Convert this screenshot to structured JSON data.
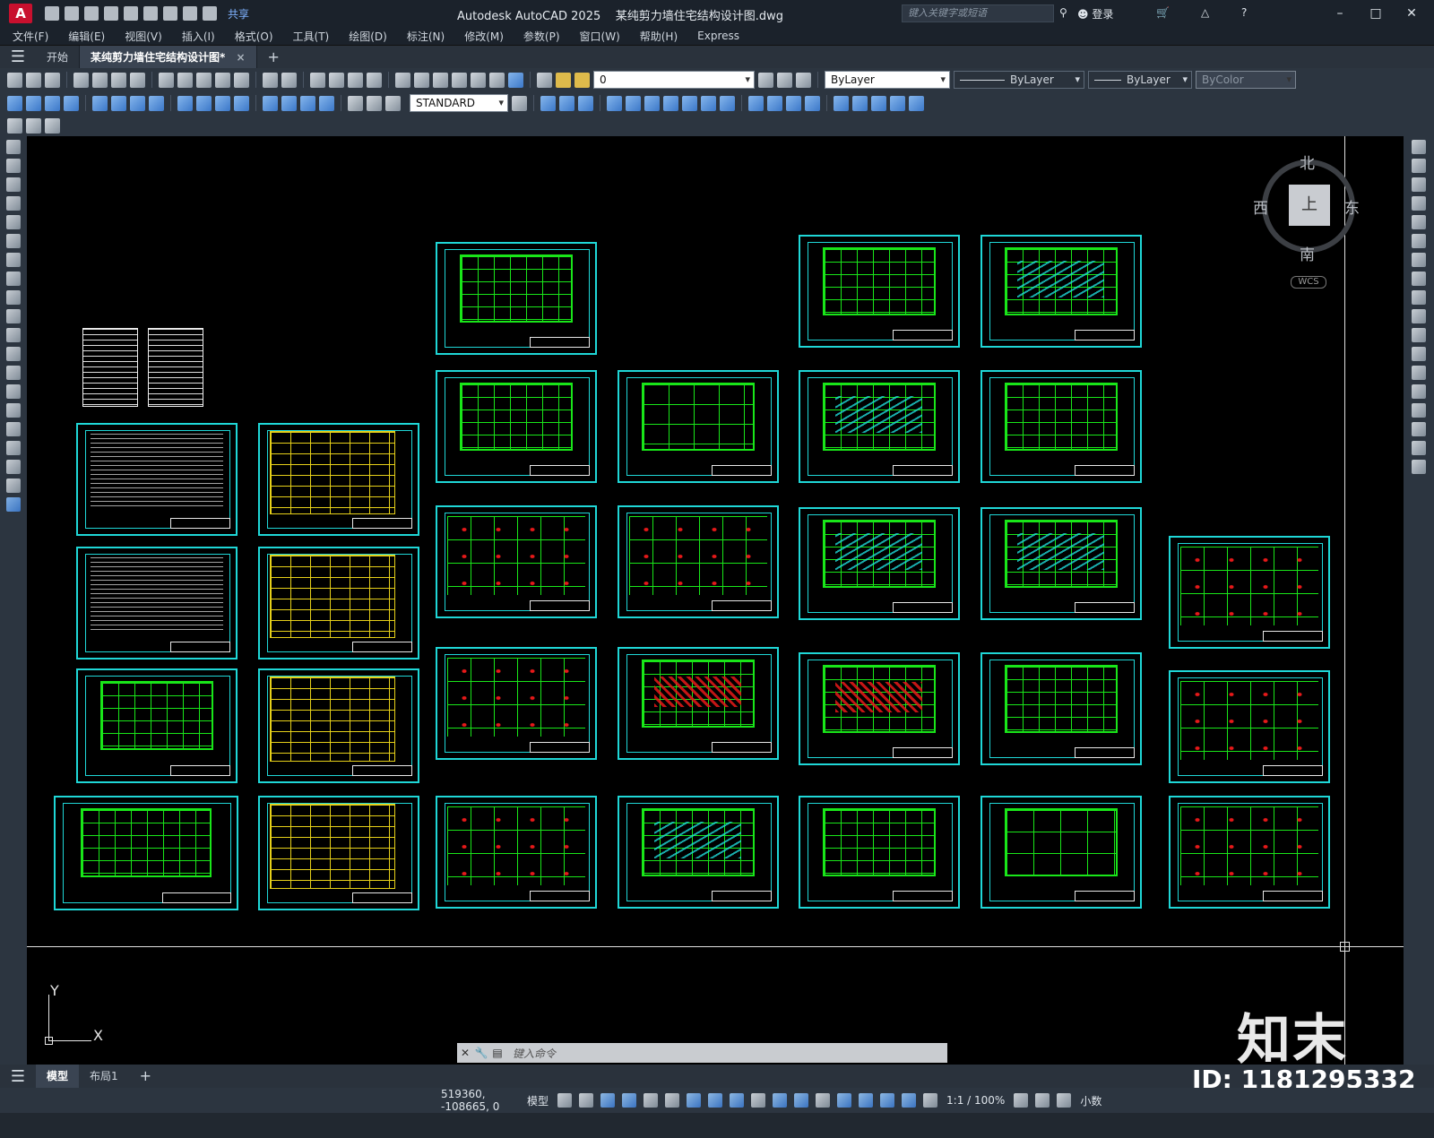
{
  "window": {
    "app_title": "Autodesk AutoCAD 2025",
    "file_title": "某纯剪力墙住宅结构设计图.dwg",
    "search_placeholder": "键入关键字或短语",
    "login": "登录",
    "share": "共享",
    "help": "?"
  },
  "menu": [
    "文件(F)",
    "编辑(E)",
    "视图(V)",
    "插入(I)",
    "格式(O)",
    "工具(T)",
    "绘图(D)",
    "标注(N)",
    "修改(M)",
    "参数(P)",
    "窗口(W)",
    "帮助(H)",
    "Express"
  ],
  "tabs": {
    "start": "开始",
    "active_doc": "某纯剪力墙住宅结构设计图*",
    "close": "×",
    "add": "+"
  },
  "toolbar": {
    "layer_value": "0",
    "text_style": "STANDARD",
    "color": "ByLayer",
    "linetype": "ByLayer",
    "lineweight": "ByLayer",
    "plotstyle": "ByColor"
  },
  "viewcube": {
    "north": "北",
    "south": "南",
    "east": "东",
    "west": "西",
    "face": "上",
    "wcs": "WCS"
  },
  "ucs": {
    "x": "X",
    "y": "Y"
  },
  "command": {
    "placeholder": "键入命令"
  },
  "layout_tabs": {
    "model": "模型",
    "layout1": "布局1",
    "add": "+"
  },
  "status": {
    "coordinates": "519360, -108665, 0",
    "mode": "模型",
    "scale": "1:1 / 100%",
    "units": "小数"
  },
  "watermark": {
    "logo": "知末",
    "id": "ID: 1181295332"
  },
  "colors": {
    "sheet_border": "#1fd7d7",
    "plan_lines": "#19e619",
    "table_lines": "#e6d019",
    "detail_red": "#e61919"
  }
}
